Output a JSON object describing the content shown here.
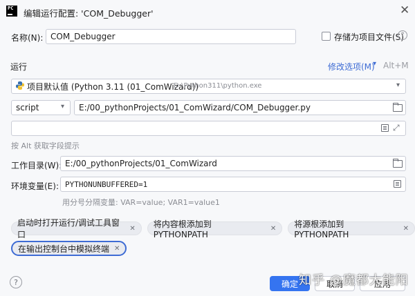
{
  "window": {
    "app_icon_text": "PC",
    "title": "编辑运行配置: 'COM_Debugger'"
  },
  "name": {
    "label": "名称(N):",
    "value": "COM_Debugger"
  },
  "store_as_project_file": {
    "label": "存储为项目文件(S)",
    "checked": false
  },
  "run_section": {
    "title": "运行",
    "modify_options_label": "修改选项(M)",
    "modify_options_shortcut": "Alt+M"
  },
  "interpreter": {
    "name": "项目默认值 (Python 3.11 (01_ComWizard))",
    "path": "D:\\Python311\\python.exe"
  },
  "script": {
    "type_value": "script",
    "path": "E:/00_pythonProjects/01_ComWizard/COM_Debugger.py"
  },
  "script_params": {
    "value": "",
    "hint": "按 Alt 获取字段提示"
  },
  "working_dir": {
    "label": "工作目录(W):",
    "value": "E:/00_pythonProjects/01_ComWizard"
  },
  "env_vars": {
    "label": "环境变量(E):",
    "value": "PYTHONUNBUFFERED=1",
    "hint": "用分号分隔变量: VAR=value; VAR1=value1"
  },
  "chips": [
    {
      "label": "启动时打开运行/调试工具窗口"
    },
    {
      "label": "将内容根添加到 PYTHONPATH"
    },
    {
      "label": "将源根添加到 PYTHONPATH"
    },
    {
      "label": "在输出控制台中模拟终端"
    }
  ],
  "buttons": {
    "help": "?",
    "ok": "确定",
    "cancel": "取消",
    "apply": "应用"
  },
  "watermark": "知乎 @魔都大能阳",
  "colors": {
    "accent": "#3574f0",
    "link": "#3d6bd4",
    "background": "#f7f8fa"
  }
}
